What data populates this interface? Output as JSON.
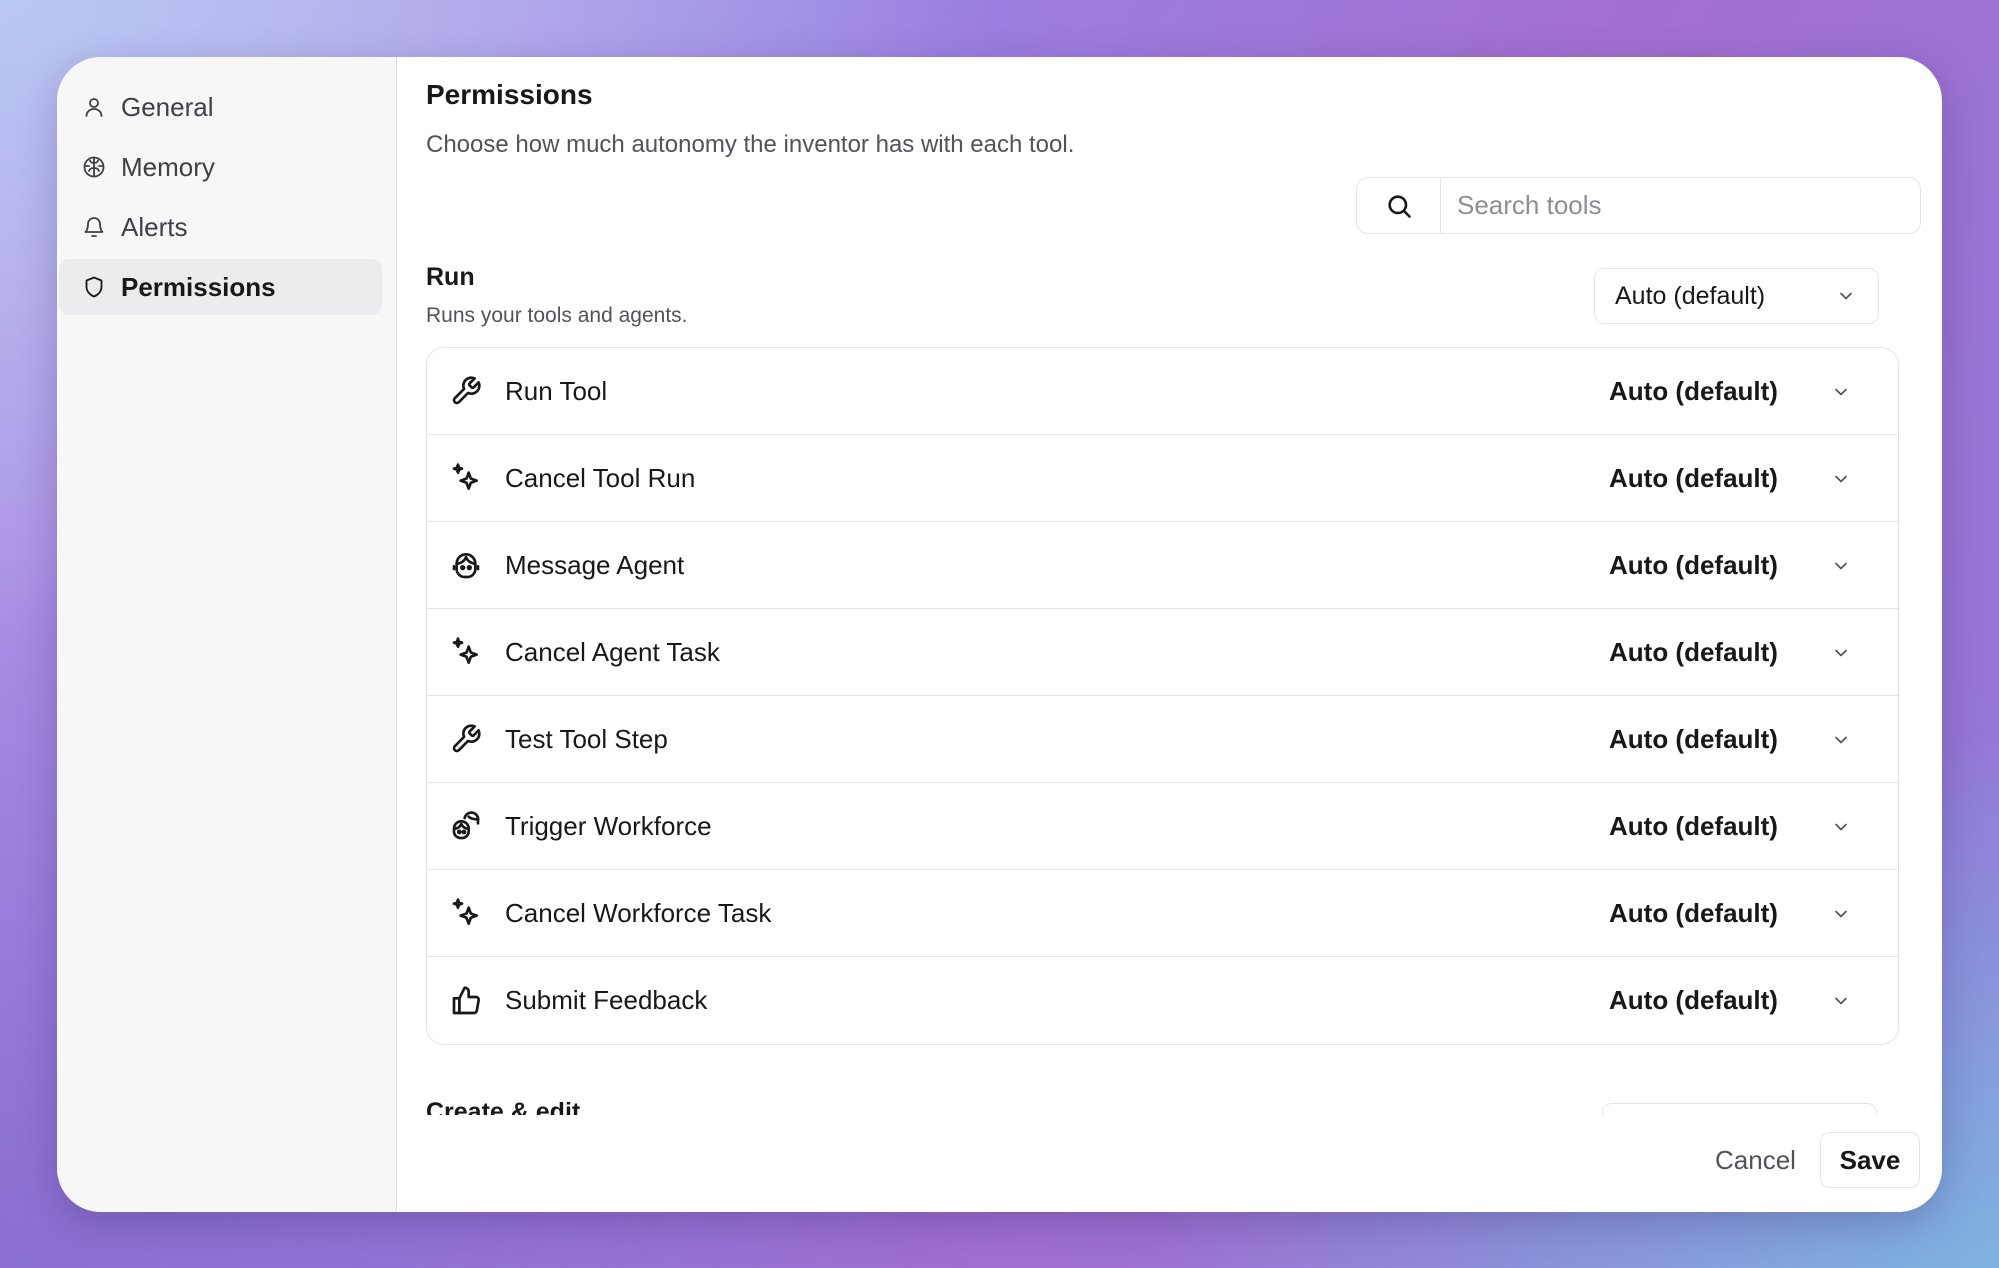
{
  "sidebar": {
    "items": [
      {
        "label": "General",
        "icon": "user-icon",
        "active": false
      },
      {
        "label": "Memory",
        "icon": "brain-icon",
        "active": false
      },
      {
        "label": "Alerts",
        "icon": "bell-icon",
        "active": false
      },
      {
        "label": "Permissions",
        "icon": "shield-icon",
        "active": true
      }
    ]
  },
  "header": {
    "title": "Permissions",
    "description": "Choose how much autonomy the inventor has with each tool."
  },
  "search": {
    "placeholder": "Search tools",
    "value": ""
  },
  "sections": [
    {
      "title": "Run",
      "description": "Runs your tools and agents.",
      "permission": "Auto (default)",
      "tools": [
        {
          "name": "Run Tool",
          "icon": "wrench-icon",
          "permission": "Auto (default)"
        },
        {
          "name": "Cancel Tool Run",
          "icon": "sparkles-icon",
          "permission": "Auto (default)"
        },
        {
          "name": "Message Agent",
          "icon": "agent-face-icon",
          "permission": "Auto (default)"
        },
        {
          "name": "Cancel Agent Task",
          "icon": "sparkles-icon",
          "permission": "Auto (default)"
        },
        {
          "name": "Test Tool Step",
          "icon": "wrench-icon",
          "permission": "Auto (default)"
        },
        {
          "name": "Trigger Workforce",
          "icon": "agents-group-icon",
          "permission": "Auto (default)"
        },
        {
          "name": "Cancel Workforce Task",
          "icon": "sparkles-icon",
          "permission": "Auto (default)"
        },
        {
          "name": "Submit Feedback",
          "icon": "thumbs-up-icon",
          "permission": "Auto (default)"
        }
      ]
    },
    {
      "title": "Create & edit"
    }
  ],
  "footer": {
    "cancel_label": "Cancel",
    "save_label": "Save"
  }
}
